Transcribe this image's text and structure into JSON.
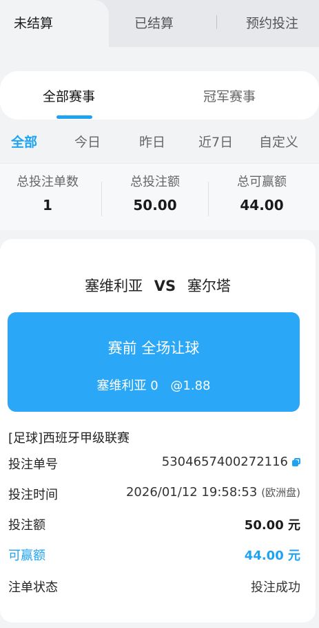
{
  "top_tabs": {
    "unsettled": "未结算",
    "settled": "已结算",
    "reserved": "预约投注"
  },
  "event_tabs": {
    "all": "全部赛事",
    "champion": "冠军赛事"
  },
  "date_filters": [
    "全部",
    "今日",
    "昨日",
    "近7日",
    "自定义"
  ],
  "summary": {
    "count_label": "总投注单数",
    "count_value": "1",
    "amount_label": "总投注额",
    "amount_value": "50.00",
    "win_label": "总可赢额",
    "win_value": "44.00"
  },
  "bet": {
    "home": "塞维利亚",
    "vs": "VS",
    "away": "塞尔塔",
    "type": "赛前 全场让球",
    "selection": "塞维利亚 0",
    "odds": "@1.88",
    "league": "[足球]西班牙甲级联赛",
    "order_label": "投注单号",
    "order_value": "5304657400272116",
    "time_label": "投注时间",
    "time_value": "2026/01/12 19:58:53",
    "odds_kind": "(欧洲盘)",
    "stake_label": "投注额",
    "stake_value": "50.00 元",
    "win_label": "可赢额",
    "win_value": "44.00 元",
    "status_label": "注单状态",
    "status_value": "投注成功"
  },
  "colors": {
    "accent": "#1ea3f3",
    "bet_box": "#2aa7f6",
    "background": "#f2f3f5"
  },
  "icons": {
    "copy": "copy-icon"
  }
}
